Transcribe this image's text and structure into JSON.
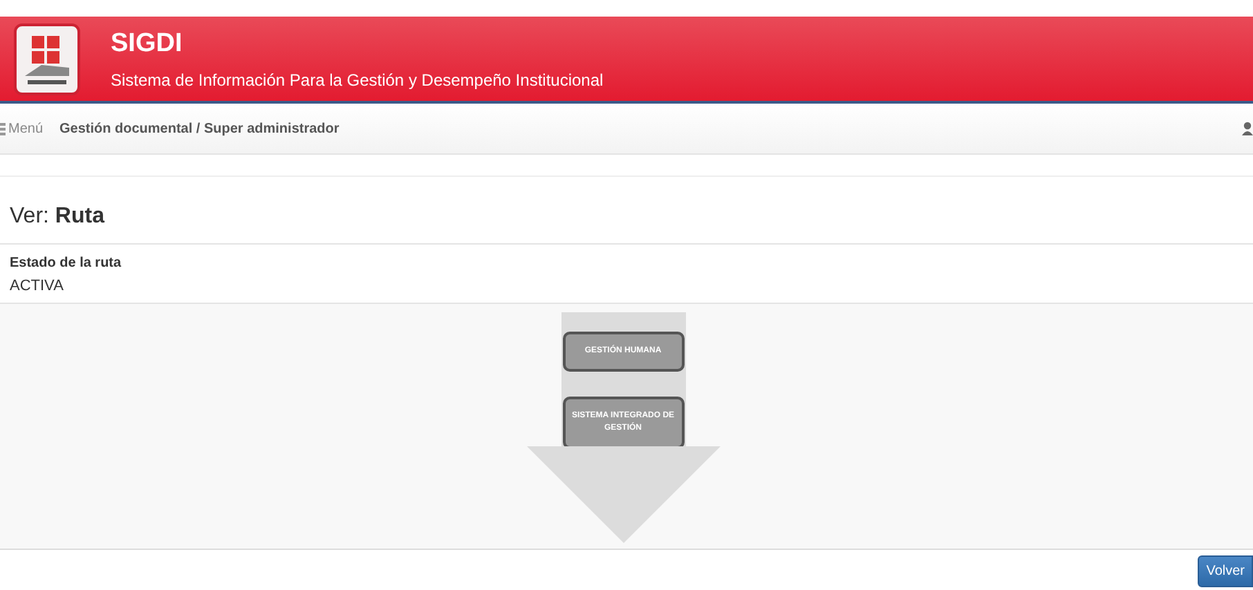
{
  "header": {
    "title": "SIGDI",
    "subtitle": "Sistema de Información Para la Gestión y Desempeño Institucional"
  },
  "nav": {
    "menu_label": "Menú",
    "breadcrumb": "Gestión documental / Super administrador"
  },
  "page_heading": "Ver: **Ruta**",
  "field": {
    "label": "Estado de la ruta",
    "value": "ACTIVA"
  },
  "route_steps": [
    {
      "label": "GESTIÓN HUMANA"
    },
    {
      "label": "SISTEMA INTEGRADO DE GESTIÓN"
    }
  ],
  "buttons": [
    {
      "label": "Volver"
    }
  ]
}
